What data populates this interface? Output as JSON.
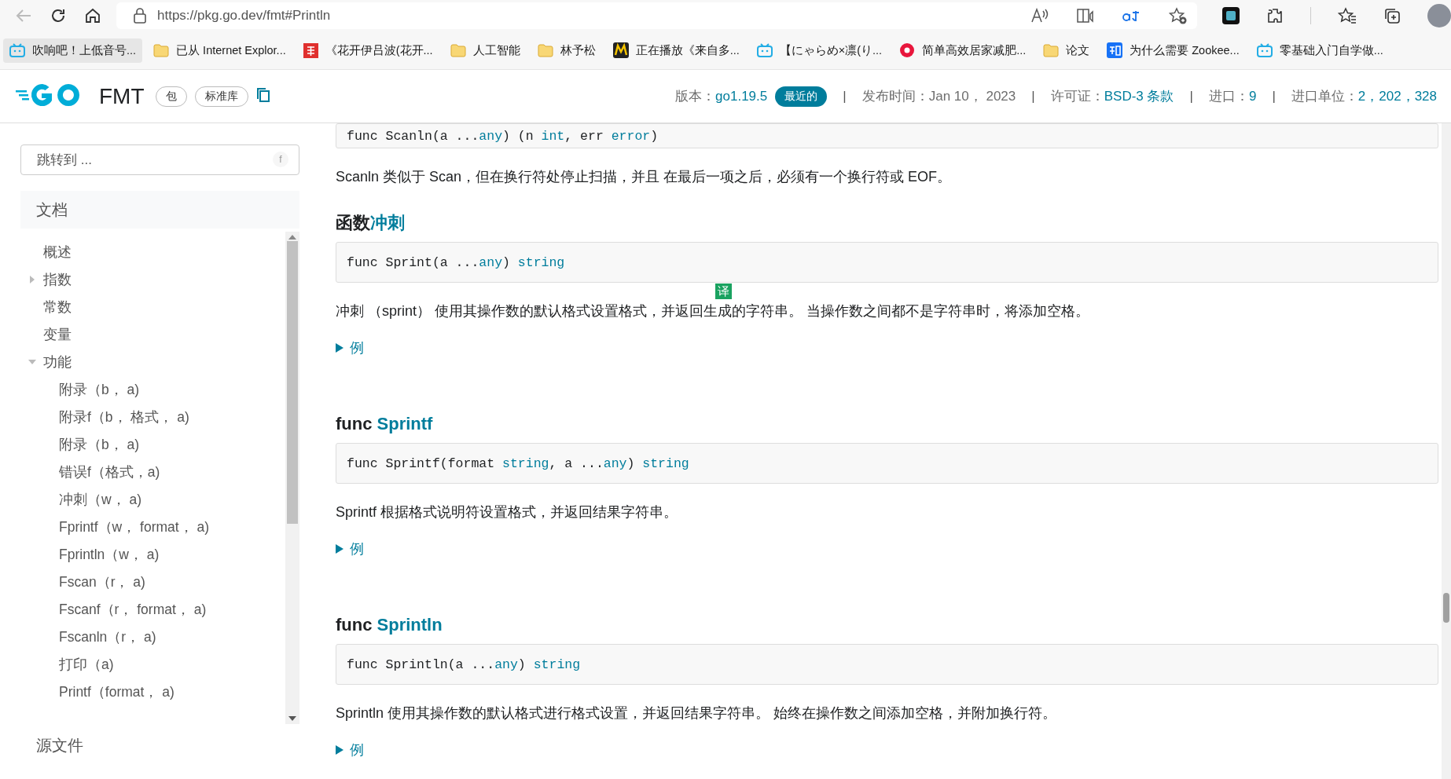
{
  "browser": {
    "address": "https://pkg.go.dev/fmt#Println",
    "bookmarks": [
      {
        "kind": "tv",
        "label": "吹响吧！上低音号...",
        "selected": true
      },
      {
        "kind": "folder",
        "label": "已从 Internet Explor...",
        "selected": false
      },
      {
        "kind": "danmaku",
        "label": "《花开伊吕波(花开...",
        "selected": false
      },
      {
        "kind": "folder",
        "label": "人工智能",
        "selected": false
      },
      {
        "kind": "folder",
        "label": "林予松",
        "selected": false
      },
      {
        "kind": "music",
        "label": "正在播放《来自多...",
        "selected": false
      },
      {
        "kind": "tv",
        "label": "【にゃらめ×凛(り...",
        "selected": false
      },
      {
        "kind": "circle",
        "label": "简单高效居家减肥...",
        "selected": false
      },
      {
        "kind": "folder",
        "label": "论文",
        "selected": false
      },
      {
        "kind": "zhihu",
        "label": "为什么需要 Zookee...",
        "selected": false
      },
      {
        "kind": "tv",
        "label": "零基础入门自学做...",
        "selected": false
      }
    ]
  },
  "header": {
    "title": "FMT",
    "tags": [
      "包",
      "标准库"
    ],
    "meta": [
      {
        "label": "版本：",
        "value": "go1.19.5",
        "badge": "最近的"
      },
      {
        "separator": "|",
        "label": "发布时间：",
        "value": "Jan 10， 2023",
        "kind": "plain"
      },
      {
        "separator": "|",
        "label": "许可证：",
        "value": "BSD-3 条款",
        "kind": "link"
      },
      {
        "separator": "|",
        "label": "进口：",
        "value": "9",
        "kind": "link"
      },
      {
        "separator": "|",
        "label": "进口单位：",
        "value": "2，202，328",
        "kind": "link"
      }
    ]
  },
  "sidebar": {
    "search": {
      "placeholder": "跳转到 ...",
      "shortcut": "f"
    },
    "section": "文档",
    "items": [
      {
        "label": "概述",
        "kind": "leaf"
      },
      {
        "label": "指数",
        "kind": "group",
        "expanded": false
      },
      {
        "label": "常数",
        "kind": "leaf"
      },
      {
        "label": "变量",
        "kind": "leaf"
      },
      {
        "label": "功能",
        "kind": "group",
        "expanded": true,
        "children": [
          {
            "label": "附录（b， a)"
          },
          {
            "label": "附录f（b， 格式， a)"
          },
          {
            "label": "附录（b， a)"
          },
          {
            "label": "错误f（格式，a)"
          },
          {
            "label": "冲刺（w， a)"
          },
          {
            "label": "Fprintf（w， format， a)"
          },
          {
            "label": "Fprintln（w， a)"
          },
          {
            "label": "Fscan（r， a)"
          },
          {
            "label": "Fscanf（r， format， a)"
          },
          {
            "label": "Fscanln（r， a)"
          },
          {
            "label": "打印（a)"
          },
          {
            "label": "Printf（format， a)"
          }
        ]
      }
    ],
    "footer_item": "源文件"
  },
  "content": {
    "sections": [
      {
        "code": [
          {
            "text": "func Scanln(a ...",
            "kind": "plain"
          },
          {
            "text": "any",
            "kind": "type"
          },
          {
            "text": ") (n ",
            "kind": "plain"
          },
          {
            "text": "int",
            "kind": "type"
          },
          {
            "text": ", err ",
            "kind": "plain"
          },
          {
            "text": "error",
            "kind": "type"
          },
          {
            "text": ")",
            "kind": "plain"
          }
        ],
        "description": "Scanln 类似于 Scan，但在换行符处停止扫描，并且 在最后一项之后，必须有一个换行符或 EOF。"
      },
      {
        "heading": [
          {
            "text": "函数",
            "kind": "plain"
          },
          {
            "text": "冲刺",
            "kind": "link"
          }
        ],
        "code": [
          {
            "text": "func Sprint(a ...",
            "kind": "plain"
          },
          {
            "text": "any",
            "kind": "type"
          },
          {
            "text": ") ",
            "kind": "plain"
          },
          {
            "text": "string",
            "kind": "type"
          }
        ],
        "description": "冲刺 （sprint） 使用其操作数的默认格式设置格式，并返回生成的字符串。 当操作数之间都不是字符串时，将添加空格。",
        "example": "例",
        "translate_badge": "译"
      },
      {
        "heading": [
          {
            "text": "func ",
            "kind": "plain"
          },
          {
            "text": "Sprintf",
            "kind": "link"
          }
        ],
        "code": [
          {
            "text": "func Sprintf(format ",
            "kind": "plain"
          },
          {
            "text": "string",
            "kind": "type"
          },
          {
            "text": ", a ...",
            "kind": "plain"
          },
          {
            "text": "any",
            "kind": "type"
          },
          {
            "text": ") ",
            "kind": "plain"
          },
          {
            "text": "string",
            "kind": "type"
          }
        ],
        "description": "Sprintf 根据格式说明符设置格式，并返回结果字符串。",
        "example": "例"
      },
      {
        "heading": [
          {
            "text": "func ",
            "kind": "plain"
          },
          {
            "text": "Sprintln",
            "kind": "link"
          }
        ],
        "code": [
          {
            "text": "func Sprintln(a ...",
            "kind": "plain"
          },
          {
            "text": "any",
            "kind": "type"
          },
          {
            "text": ") ",
            "kind": "plain"
          },
          {
            "text": "string",
            "kind": "type"
          }
        ],
        "description": "Sprintln 使用其操作数的默认格式进行格式设置，并返回结果字符串。 始终在操作数之间添加空格，并附加换行符。",
        "example": "例"
      }
    ]
  }
}
